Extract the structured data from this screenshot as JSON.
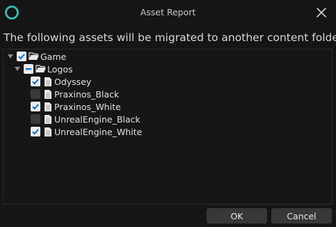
{
  "window": {
    "title": "Asset Report",
    "logo_icon": "unreal-engine-logo-icon",
    "close_icon": "close-icon"
  },
  "header": {
    "message": "The following assets will be migrated to another content folder."
  },
  "tree": {
    "root": {
      "label": "Game",
      "state": "checked",
      "expanded": true,
      "icon": "folder-open-icon"
    },
    "folder": {
      "label": "Logos",
      "state": "partial",
      "expanded": true,
      "icon": "folder-open-icon"
    },
    "items": [
      {
        "label": "Odyssey",
        "state": "checked",
        "icon": "asset-file-icon"
      },
      {
        "label": "Praxinos_Black",
        "state": "unchecked",
        "icon": "asset-file-icon"
      },
      {
        "label": "Praxinos_White",
        "state": "checked",
        "icon": "asset-file-icon"
      },
      {
        "label": "UnrealEngine_Black",
        "state": "unchecked",
        "icon": "asset-file-icon"
      },
      {
        "label": "UnrealEngine_White",
        "state": "checked",
        "icon": "asset-file-icon"
      }
    ]
  },
  "buttons": {
    "ok": "OK",
    "cancel": "Cancel"
  },
  "colors": {
    "background": "#151515",
    "accent": "#0070e0",
    "checkbox_on": "#ebebeb",
    "button": "#383838"
  }
}
